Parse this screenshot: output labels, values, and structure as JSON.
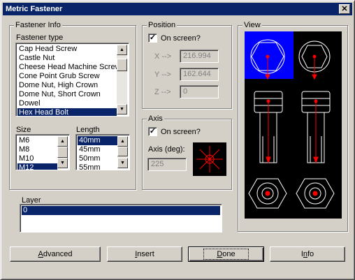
{
  "window": {
    "title": "Metric Fastener",
    "close_glyph": "✕"
  },
  "fastener_info": {
    "group_title": "Fastener Info",
    "type_label": "Fastener type",
    "types": [
      {
        "label": "Cap Head Screw",
        "selected": false
      },
      {
        "label": "Castle Nut",
        "selected": false
      },
      {
        "label": "Cheese Head Machine Screw",
        "selected": false
      },
      {
        "label": "Cone Point Grub Screw",
        "selected": false
      },
      {
        "label": "Dome Nut, High Crown",
        "selected": false
      },
      {
        "label": "Dome Nut, Short Crown",
        "selected": false
      },
      {
        "label": "Dowel",
        "selected": false
      },
      {
        "label": "Hex Head Bolt",
        "selected": true
      }
    ],
    "size_label": "Size",
    "sizes": [
      {
        "label": "M6",
        "selected": false
      },
      {
        "label": "M8",
        "selected": false
      },
      {
        "label": "M10",
        "selected": false
      },
      {
        "label": "M12",
        "selected": true
      }
    ],
    "length_label": "Length",
    "lengths": [
      {
        "label": "40mm",
        "selected": true
      },
      {
        "label": "45mm",
        "selected": false
      },
      {
        "label": "50mm",
        "selected": false
      },
      {
        "label": "55mm",
        "selected": false
      }
    ]
  },
  "position": {
    "group_title": "Position",
    "on_screen_label": "On screen?",
    "on_screen_checked": true,
    "x_label": "X -->",
    "x_value": "216.994",
    "y_label": "Y -->",
    "y_value": "162.644",
    "z_label": "Z -->",
    "z_value": "0"
  },
  "axis": {
    "group_title": "Axis",
    "on_screen_label": "On screen?",
    "on_screen_checked": true,
    "deg_label": "Axis (deg):",
    "deg_value": "225"
  },
  "view": {
    "group_title": "View"
  },
  "layer": {
    "label": "Layer",
    "items": [
      {
        "label": "0",
        "selected": true
      }
    ]
  },
  "buttons": {
    "advanced": {
      "pre": "",
      "accel": "A",
      "post": "dvanced"
    },
    "insert": {
      "pre": "",
      "accel": "I",
      "post": "nsert"
    },
    "done": {
      "pre": "",
      "accel": "D",
      "post": "one"
    },
    "info": {
      "pre": "I",
      "accel": "n",
      "post": "fo"
    }
  },
  "colors": {
    "titlebar": "#0a246a",
    "selection": "#0a246a",
    "view_bg": "#000000",
    "view_highlight": "#0000ff",
    "axis_arrow": "#ff0000"
  }
}
